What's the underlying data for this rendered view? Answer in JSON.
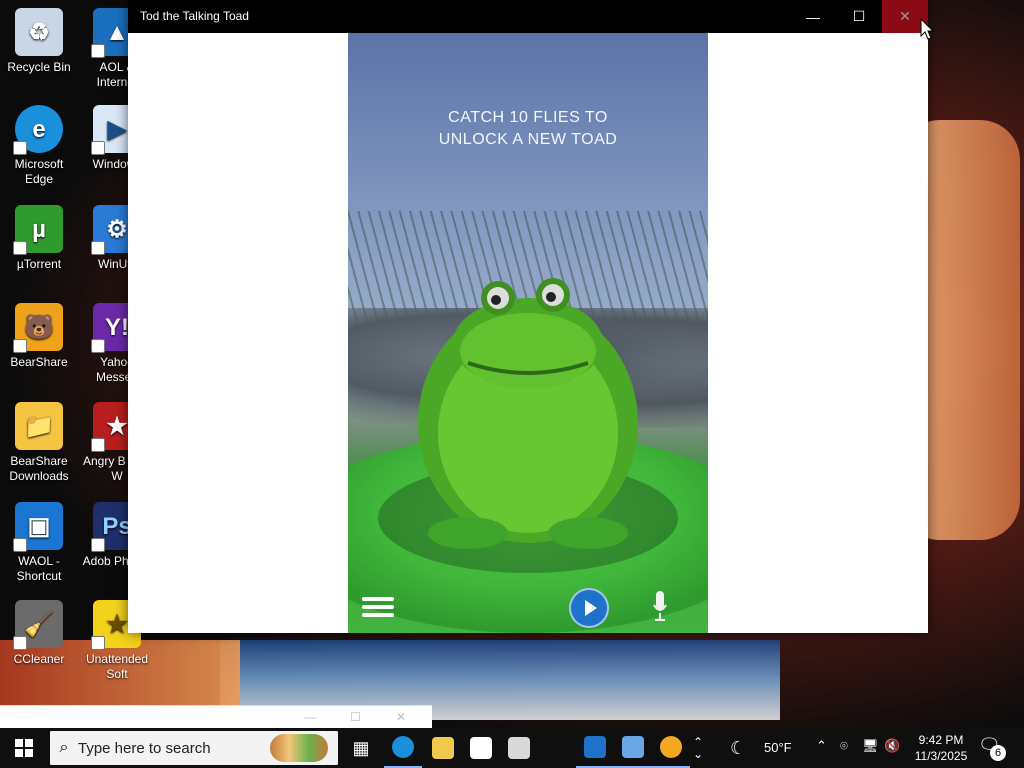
{
  "desktop": {
    "icons": [
      {
        "label": "Recycle Bin",
        "icon": "recycle-bin-icon",
        "color": "#c9d6e6"
      },
      {
        "label": "AOL & Internet",
        "icon": "aol-icon",
        "color": "#1b6fbf"
      },
      {
        "label": "Microsoft Edge",
        "icon": "edge-icon",
        "color": "#1a8fdc"
      },
      {
        "label": "Windows",
        "icon": "windows-app-icon",
        "color": "#d9e7f7"
      },
      {
        "label": "µTorrent",
        "icon": "utorrent-icon",
        "color": "#2f9a2e"
      },
      {
        "label": "WinUtil",
        "icon": "winutil-icon",
        "color": "#2a7bd6"
      },
      {
        "label": "BearShare",
        "icon": "bearshare-icon",
        "color": "#f0a31a"
      },
      {
        "label": "Yahoo Messen",
        "icon": "yahoo-messenger-icon",
        "color": "#6a2aa8"
      },
      {
        "label": "BearShare Downloads",
        "icon": "bearshare-downloads-icon",
        "color": "#f5c542"
      },
      {
        "label": "Angry B Star W",
        "icon": "angry-birds-star-wars-icon",
        "color": "#b81e1e"
      },
      {
        "label": "WAOL - Shortcut",
        "icon": "waol-shortcut-icon",
        "color": "#1a76d2"
      },
      {
        "label": "Adob Photos",
        "icon": "photoshop-icon",
        "color": "#1f2f6b"
      },
      {
        "label": "CCleaner",
        "icon": "ccleaner-icon",
        "color": "#6b6b6b"
      },
      {
        "label": "Unattended Soft",
        "icon": "unattended-soft-icon",
        "color": "#f2d21b"
      }
    ]
  },
  "window": {
    "title": "Tod the Talking Toad",
    "buttons": {
      "minimize": "—",
      "maximize": "☐",
      "close": "✕"
    }
  },
  "game": {
    "hint_line1": "CATCH 10 FLIES TO",
    "hint_line2": "UNLOCK A NEW TOAD",
    "icons": {
      "menu": "menu-icon",
      "play": "play-icon",
      "mic": "microphone-icon"
    }
  },
  "mini_window": {
    "controls": {
      "minimize": "—",
      "maximize": "☐",
      "close": "✕"
    }
  },
  "taskbar": {
    "search_placeholder": "Type here to search",
    "weather": "50°F",
    "time": "9:42 PM",
    "date": "11/3/2025",
    "notifications_count": "6",
    "apps": [
      "task-view-icon",
      "edge-icon",
      "file-explorer-icon",
      "store-icon",
      "mail-icon",
      "activity-icon",
      "control-panel-icon",
      "downloader-icon"
    ]
  },
  "colors": {
    "titlebar": "#000000",
    "taskbar": "#0f0f0f",
    "accent": "#1e73c8",
    "frog_green": "#5fbd2f"
  }
}
